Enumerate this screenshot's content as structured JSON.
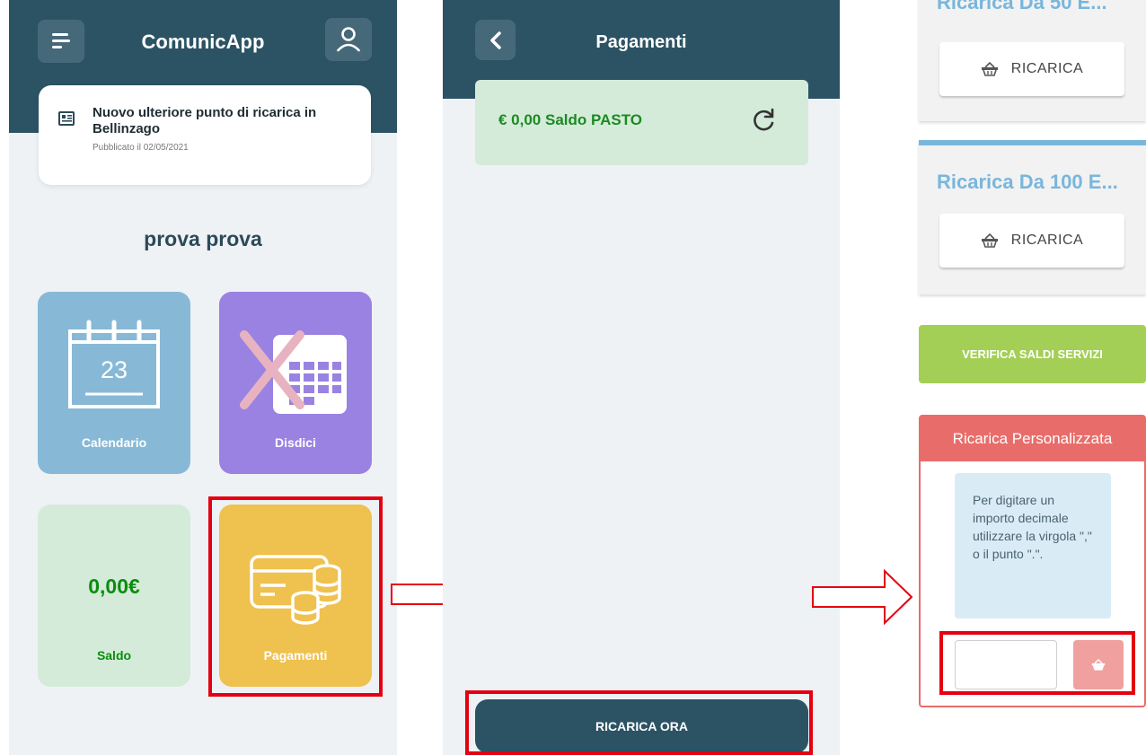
{
  "panel_home": {
    "app_title": "ComunicApp",
    "news": {
      "title": "Nuovo ulteriore punto di ricarica in Bellinzago",
      "date": "Pubblicato il 02/05/2021"
    },
    "user_name": "prova prova",
    "tiles": {
      "calendario": {
        "label": "Calendario",
        "day": "23"
      },
      "disdici": {
        "label": "Disdici"
      },
      "saldo": {
        "label": "Saldo",
        "amount": "0,00€"
      },
      "pagamenti": {
        "label": "Pagamenti"
      }
    },
    "icons": {
      "menu": "menu-icon",
      "user": "user-icon",
      "news": "newspaper-icon"
    }
  },
  "panel_payments": {
    "title": "Pagamenti",
    "balance_text": "€ 0,00 Saldo PASTO",
    "recharge_button": "RICARICA ORA"
  },
  "panel_recharge": {
    "top_card_title": "Ricarica Da 50 E...",
    "top_card_button": "RICARICA",
    "card_100_title": "Ricarica Da 100 E...",
    "card_100_button": "RICARICA",
    "verify_button": "VERIFICA SALDI SERVIZI",
    "custom": {
      "header": "Ricarica Personalizzata",
      "info": "Per digitare un importo decimale utilizzare la virgola \",\" o il punto \".\".",
      "amount_value": ""
    }
  },
  "colors": {
    "header": "#2c5364",
    "tile_calendar": "#87b9d7",
    "tile_cancel": "#9a82e2",
    "tile_balance": "#d4ebd9",
    "tile_payments": "#efc14e",
    "highlight": "#e50010",
    "verify": "#a4cf56",
    "custom_header": "#e86d6a"
  }
}
